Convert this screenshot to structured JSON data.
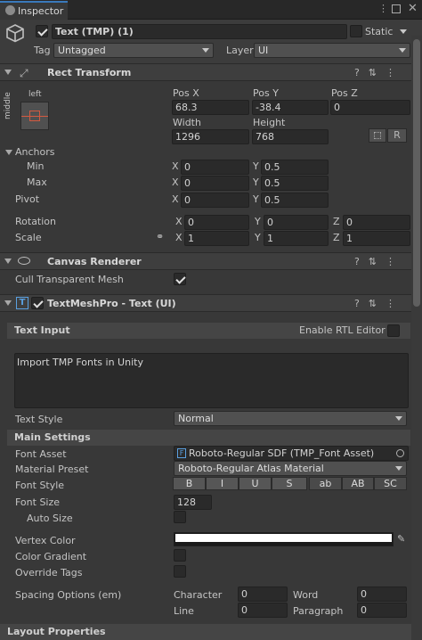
{
  "tab": {
    "title": "Inspector"
  },
  "object": {
    "name": "Text (TMP) (1)",
    "static_label": "Static",
    "tag_label": "Tag",
    "tag_value": "Untagged",
    "layer_label": "Layer",
    "layer_value": "UI"
  },
  "rect_transform": {
    "title": "Rect Transform",
    "anchor_preset_h": "left",
    "anchor_preset_v": "middle",
    "pos_x_label": "Pos X",
    "pos_x": "68.3",
    "pos_y_label": "Pos Y",
    "pos_y": "-38.4",
    "pos_z_label": "Pos Z",
    "pos_z": "0",
    "width_label": "Width",
    "width": "1296",
    "height_label": "Height",
    "height": "768",
    "r_button": "R",
    "anchors_label": "Anchors",
    "min_label": "Min",
    "min_x": "0",
    "min_y": "0.5",
    "max_label": "Max",
    "max_x": "0",
    "max_y": "0.5",
    "pivot_label": "Pivot",
    "pivot_x": "0",
    "pivot_y": "0.5",
    "rotation_label": "Rotation",
    "rot_x": "0",
    "rot_y": "0",
    "rot_z": "0",
    "scale_label": "Scale",
    "scale_x": "1",
    "scale_y": "1",
    "scale_z": "1",
    "x": "X",
    "y": "Y",
    "z": "Z"
  },
  "canvas_renderer": {
    "title": "Canvas Renderer",
    "cull_label": "Cull Transparent Mesh",
    "cull_checked": true
  },
  "tmp": {
    "title": "TextMeshPro - Text (UI)",
    "text_input_label": "Text Input",
    "rtl_label": "Enable RTL Editor",
    "text_value": "Import TMP Fonts in Unity",
    "text_style_label": "Text Style",
    "text_style_value": "Normal",
    "main_settings_label": "Main Settings",
    "font_asset_label": "Font Asset",
    "font_asset_value": "Roboto-Regular SDF (TMP_Font Asset)",
    "material_preset_label": "Material Preset",
    "material_preset_value": "Roboto-Regular Atlas Material",
    "font_style_label": "Font Style",
    "style_buttons": [
      "B",
      "I",
      "U",
      "S",
      "ab",
      "AB",
      "SC"
    ],
    "font_size_label": "Font Size",
    "font_size_value": "128",
    "auto_size_label": "Auto Size",
    "vertex_color_label": "Vertex Color",
    "vertex_color": "#ffffff",
    "color_gradient_label": "Color Gradient",
    "override_tags_label": "Override Tags",
    "spacing_label": "Spacing Options (em)",
    "character_label": "Character",
    "character_value": "0",
    "word_label": "Word",
    "word_value": "0",
    "line_label": "Line",
    "line_value": "0",
    "paragraph_label": "Paragraph",
    "paragraph_value": "0"
  },
  "layout_properties": {
    "title": "Layout Properties"
  },
  "colors": {
    "accent_blue": "#3a79bb",
    "panel": "#383838",
    "header": "#3e3e3e"
  }
}
